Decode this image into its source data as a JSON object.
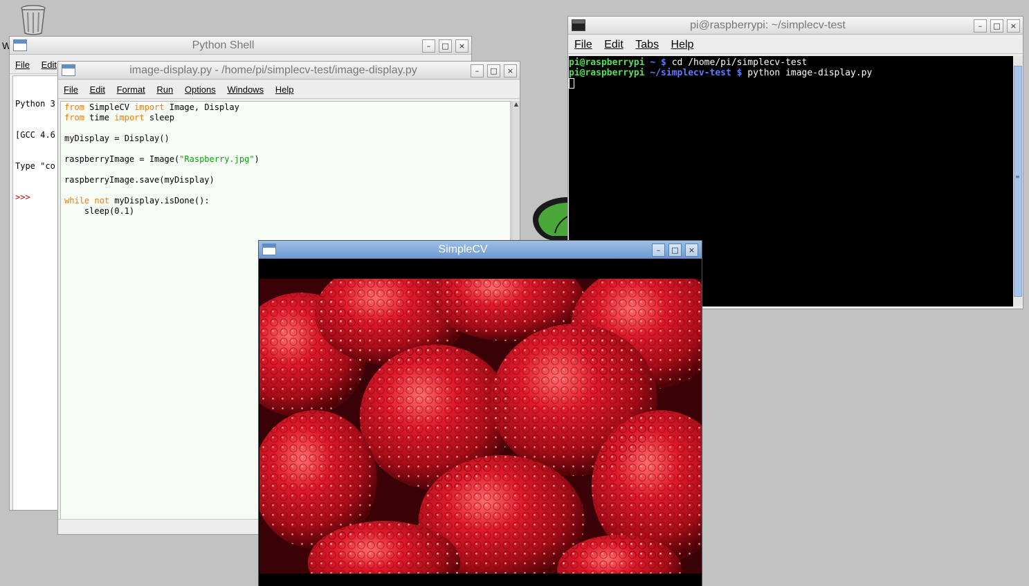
{
  "desktop": {
    "trash_icon": "trash-icon",
    "leaf_icon": "raspberry-leaf-icon",
    "shell_label_fragment": "W"
  },
  "shell": {
    "title": "Python Shell",
    "menu": [
      "File",
      "Edit"
    ],
    "lines": [
      "Python 3",
      "[GCC 4.6",
      "Type \"co"
    ],
    "prompt": ">>>",
    "buttons": {
      "minimize": "–",
      "maximize": "□",
      "close": "×"
    }
  },
  "editor": {
    "title": "image-display.py - /home/pi/simplecv-test/image-display.py",
    "menu": [
      "File",
      "Edit",
      "Format",
      "Run",
      "Options",
      "Windows",
      "Help"
    ],
    "code": {
      "l1": {
        "kw1": "from",
        "t1": " SimpleCV ",
        "kw2": "import",
        "t2": " Image, Display"
      },
      "l2": {
        "kw1": "from",
        "t1": " time ",
        "kw2": "import",
        "t2": " sleep"
      },
      "l4": "myDisplay = Display()",
      "l6": {
        "t1": "raspberryImage = Image(",
        "str": "\"Raspberry.jpg\"",
        "t2": ")"
      },
      "l8": "raspberryImage.save(myDisplay)",
      "l10": {
        "kw1": "while",
        "kw2": "not",
        "t1": " myDisplay.isDone():"
      },
      "l11": "    sleep(0.1)"
    },
    "colors": {
      "keyword": "#ff7700",
      "string": "#00aa00",
      "background": "#f7fcf7"
    }
  },
  "terminal": {
    "title": "pi@raspberrypi: ~/simplecv-test",
    "menu": [
      "File",
      "Edit",
      "Tabs",
      "Help"
    ],
    "line1": {
      "user": "pi@raspberrypi",
      "path": " ~ $",
      "cmd": " cd /home/pi/simplecv-test"
    },
    "line2": {
      "user": "pi@raspberrypi",
      "path": " ~/simplecv-test $",
      "cmd": " python image-display.py"
    },
    "colors": {
      "user": "#55e055",
      "path": "#5b7cff",
      "background": "#000000"
    }
  },
  "simplecv": {
    "title": "SimpleCV",
    "image_subject": "raspberries-photo"
  }
}
